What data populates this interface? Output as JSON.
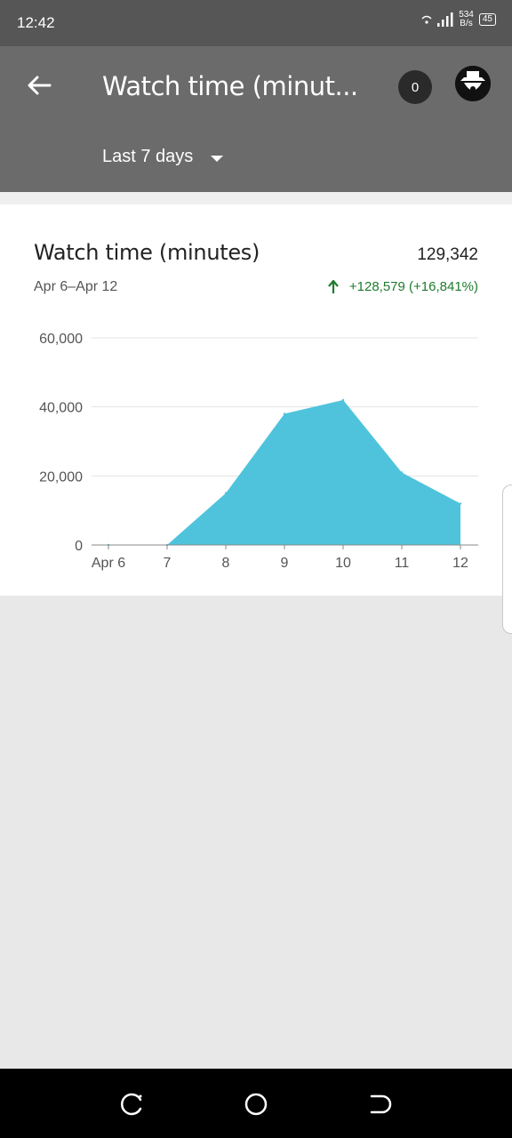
{
  "status_bar": {
    "time": "12:42",
    "net_speed_value": "534",
    "net_speed_unit": "B/s",
    "battery": "45",
    "icons": [
      "wifi-icon",
      "signal-icon",
      "battery-icon"
    ]
  },
  "app_bar": {
    "title": "Watch time (minut...",
    "notification_count": "0",
    "date_range": "Last 7 days",
    "icons": [
      "back-arrow-icon",
      "dropdown-caret-icon",
      "avatar-icon"
    ]
  },
  "card": {
    "title": "Watch time (minutes)",
    "total": "129,342",
    "period": "Apr 6–Apr 12",
    "delta": "+128,579 (+16,841%)",
    "delta_color": "#1e7b2c"
  },
  "chart_data": {
    "type": "area",
    "x": [
      "Apr 6",
      "7",
      "8",
      "9",
      "10",
      "11",
      "12"
    ],
    "y": [
      0,
      0,
      15000,
      38000,
      42000,
      21000,
      12000
    ],
    "yticks": [
      "0",
      "20,000",
      "40,000",
      "60,000"
    ],
    "ylim": [
      0,
      60000
    ],
    "grid": true,
    "color": "#4fc3dc"
  },
  "nav_bar": {
    "icons": [
      "recents-icon",
      "home-icon",
      "back-icon"
    ]
  }
}
